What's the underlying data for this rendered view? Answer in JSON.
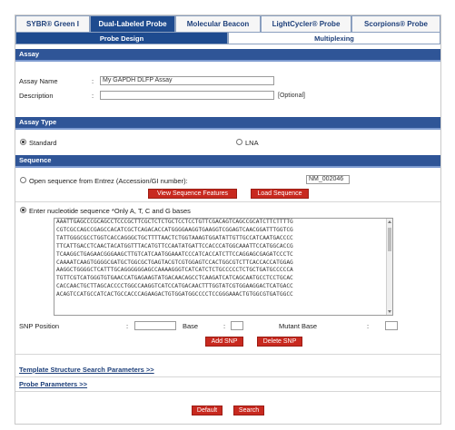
{
  "tabs": [
    {
      "label": "SYBR® Green I",
      "active": false
    },
    {
      "label": "Dual-Labeled Probe",
      "active": true
    },
    {
      "label": "Molecular Beacon",
      "active": false
    },
    {
      "label": "LightCycler® Probe",
      "active": false
    },
    {
      "label": "Scorpions® Probe",
      "active": false
    }
  ],
  "subtabs": [
    {
      "label": "Probe Design",
      "active": true
    },
    {
      "label": "Multiplexing",
      "active": false
    }
  ],
  "assay": {
    "section_title": "Assay",
    "name_label": "Assay Name",
    "name_value": "My GAPDH DLFP Assay",
    "description_label": "Description",
    "description_value": "",
    "optional_hint": "[Optional]"
  },
  "assay_type": {
    "section_title": "Assay Type",
    "options": [
      {
        "label": "Standard",
        "selected": true
      },
      {
        "label": "LNA",
        "selected": false
      }
    ]
  },
  "sequence": {
    "section_title": "Sequence",
    "open_entrez_label": "Open sequence from Entrez (Accession/GI number):",
    "open_entrez_selected": false,
    "accession_value": "NM_002046",
    "view_features_button": "View Sequence Features",
    "load_sequence_button": "Load Sequence",
    "enter_label": "Enter nucleotide sequence *Only A, T, C and G bases",
    "enter_selected": true,
    "lines": [
      "AAATTGAGCCCGCAGCCTCCCGCTTCGCTCTCTGCTCCTCCTGTTCGACAGTCAGCCGCATCTTCTTTTG",
      "CGTCGCCAGCCGAGCCACATCGCTCAGACACCATGGGGAAGGTGAAGGTCGGAGTCAACGGATTTGGTCG",
      "TATTGGGCGCCTGGTCACCAGGGCTGCTTTTAACTCTGGTAAAGTGGATATTGTTGCCATCAATGACCCC",
      "TTCATTGACCTCAACTACATGGTTTACATGTTCCAATATGATTCCACCCATGGCAAATTCCATGGCACCG",
      "TCAAGGCTGAGAACGGGAAGCTTGTCATCAATGGAAATCCCATCACCATCTTCCAGGAGCGAGATCCCTC",
      "CAAAATCAAGTGGGGCGATGCTGGCGCTGAGTACGTCGTGGAGTCCACTGGCGTCTTCACCACCATGGAG",
      "AAGGCTGGGGCTCATTTGCAGGGGGGAGCCAAAAGGGTCATCATCTCTGCCCCCTCTGCTGATGCCCCCA",
      "TGTTCGTCATGGGTGTGAACCATGAGAAGTATGACAACAGCCTCAAGATCATCAGCAATGCCTCCTGCAC",
      "CACCAACTGCTTAGCACCCCTGGCCAAGGTCATCCATGACAACTTTGGTATCGTGGAAGGACTCATGACC",
      "ACAGTCCATGCCATCACTGCCACCCAGAAGACTGTGGATGGCCCCTCCGGGAAACTGTGGCGTGATGGCC"
    ]
  },
  "snp": {
    "position_label": "SNP Position",
    "position_value": "",
    "base_label": "Base",
    "base_value": "",
    "mutant_label": "Mutant Base",
    "mutant_value": "",
    "add_button": "Add SNP",
    "delete_button": "Delete SNP"
  },
  "links": {
    "template_params": "Template Structure Search Parameters >>",
    "probe_params": "Probe Parameters >>"
  },
  "footer": {
    "default_button": "Default",
    "search_button": "Search"
  },
  "colors": {
    "section_bar": "#2f5597",
    "active_tab": "#1e4b8f",
    "button_red": "#c8291f"
  }
}
